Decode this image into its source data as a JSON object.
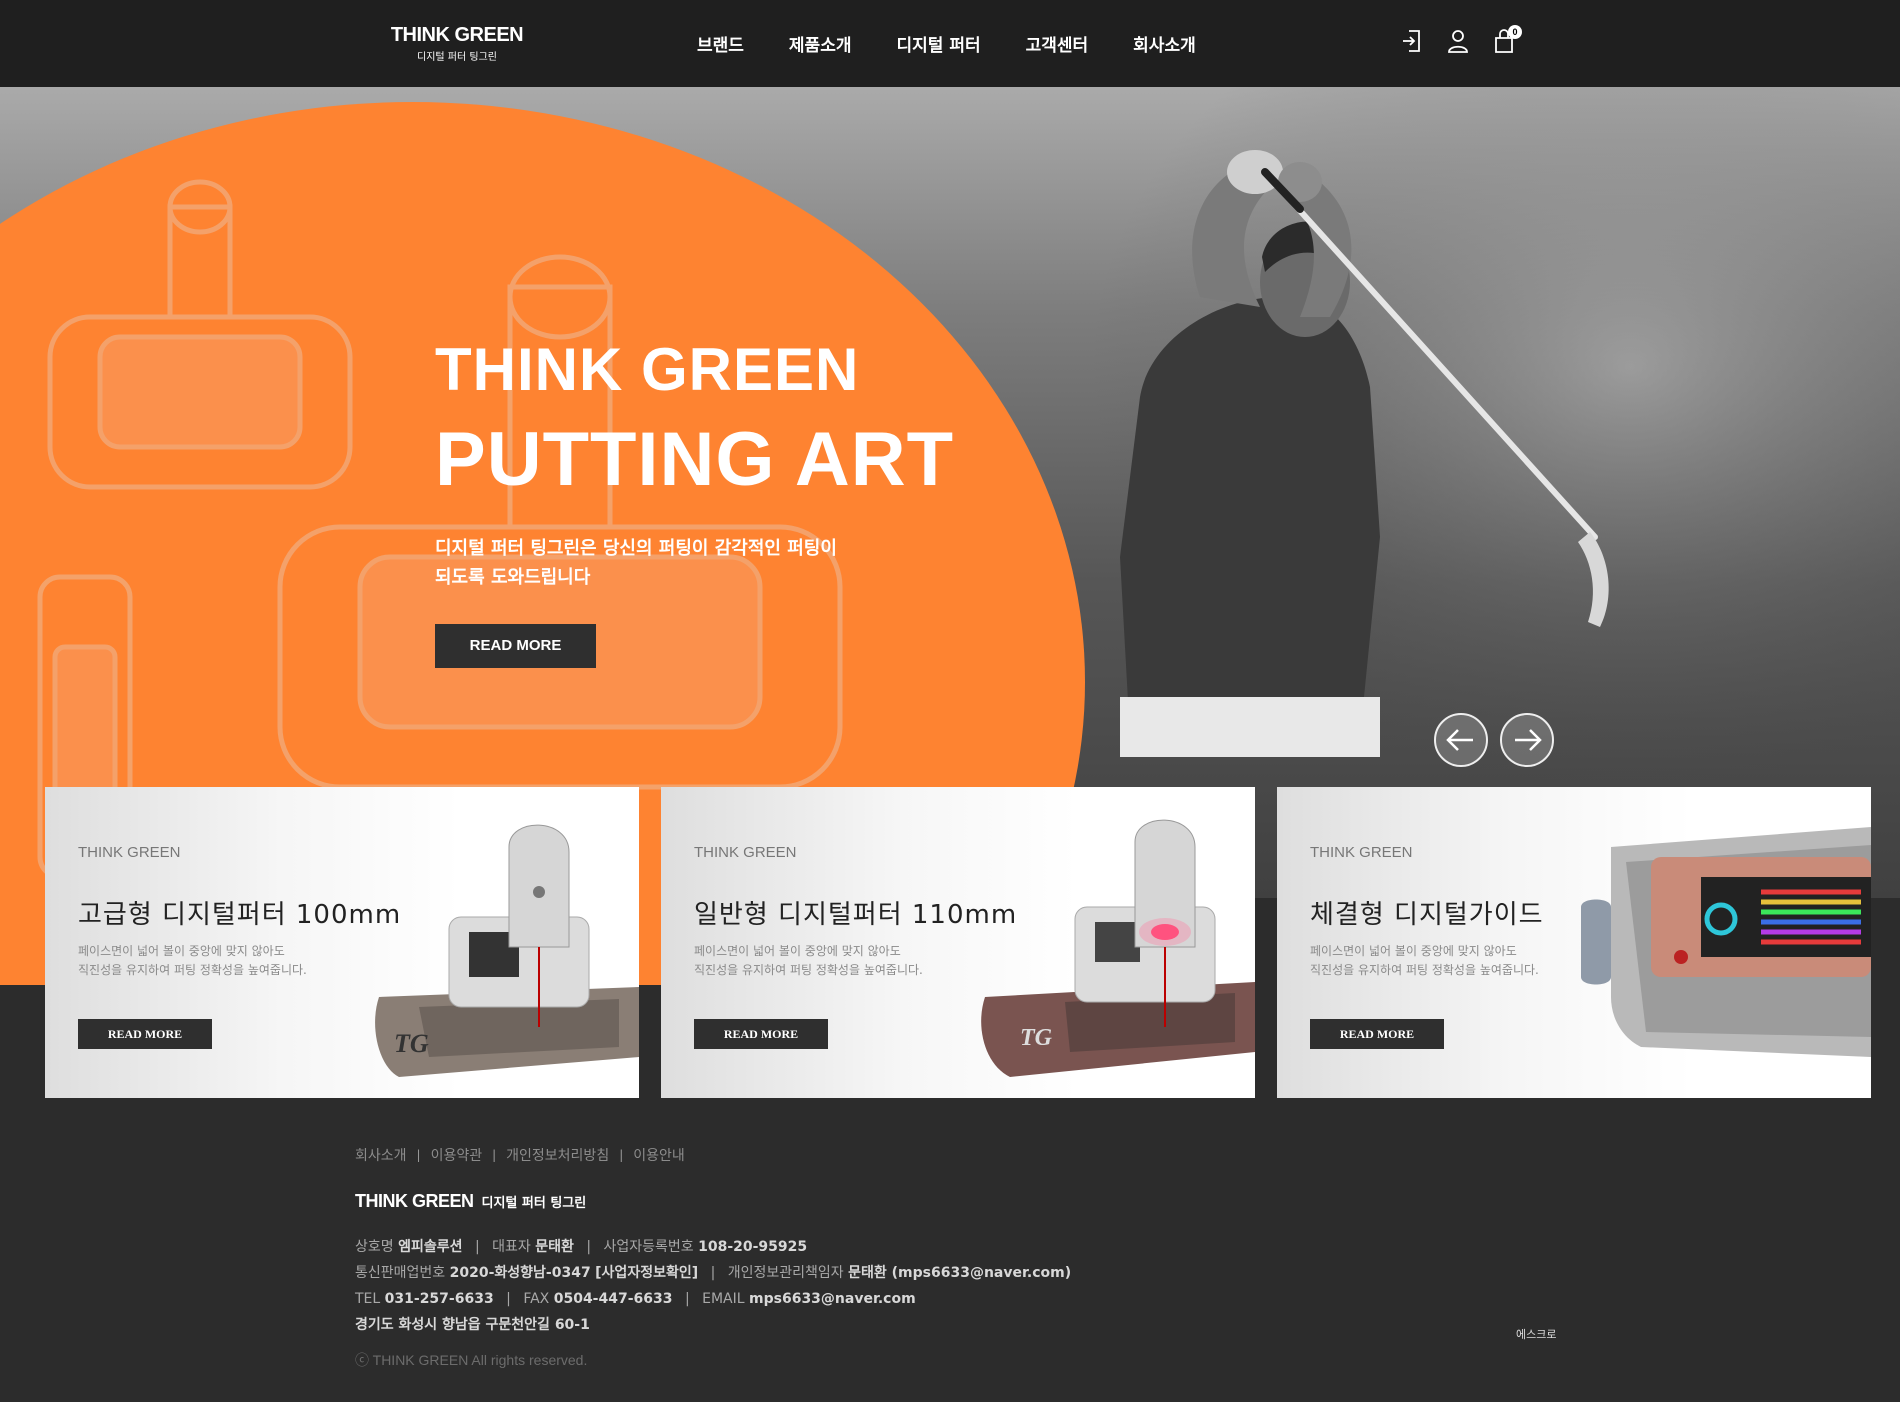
{
  "header": {
    "logo_brand": "THINK GREEN",
    "logo_sub": "디지털 퍼터 팅그린",
    "nav": [
      "브랜드",
      "제품소개",
      "디지털 퍼터",
      "고객센터",
      "회사소개"
    ],
    "cart_count": "0"
  },
  "hero": {
    "title1": "THINK GREEN",
    "title2": "PUTTING ART",
    "desc_line1": "디지털 퍼터 팅그린은 당신의 퍼팅이 감각적인 퍼팅이",
    "desc_line2": "되도록 도와드립니다",
    "button": "READ MORE"
  },
  "cards": [
    {
      "brand": "THINK GREEN",
      "title": "고급형 디지털퍼터 100mm",
      "desc1": "페이스면이 넓어 볼이 중앙에 맞지 않아도",
      "desc2": "직진성을 유지하여 퍼팅 정확성을 높여줍니다.",
      "button": "READ MORE"
    },
    {
      "brand": "THINK GREEN",
      "title": "일반형 디지털퍼터 110mm",
      "desc1": "페이스면이 넓어 볼이 중앙에 맞지 않아도",
      "desc2": "직진성을 유지하여 퍼팅 정확성을 높여줍니다.",
      "button": "READ MORE"
    },
    {
      "brand": "THINK GREEN",
      "title": "체결형 디지털가이드",
      "desc1": "페이스면이 넓어 볼이 중앙에 맞지 않아도",
      "desc2": "직진성을 유지하여 퍼팅 정확성을 높여줍니다.",
      "button": "READ MORE"
    }
  ],
  "footer": {
    "links": [
      "회사소개",
      "이용약관",
      "개인정보처리방침",
      "이용안내"
    ],
    "logo_brand": "THINK GREEN",
    "logo_sub": "디지털 퍼터 팅그린",
    "company_label": "상호명",
    "company": "엠피솔루션",
    "ceo_label": "대표자",
    "ceo": "문태환",
    "bizno_label": "사업자등록번호",
    "bizno": "108-20-95925",
    "mailorder_label": "통신판매업번호",
    "mailorder": "2020-화성향남-0347",
    "bizinfo": "[사업자정보확인]",
    "privacy_label": "개인정보관리책임자",
    "privacy": "문태환 (mps6633@naver.com)",
    "tel_label": "TEL",
    "tel": "031-257-6633",
    "fax_label": "FAX",
    "fax": "0504-447-6633",
    "email_label": "EMAIL",
    "email": "mps6633@naver.com",
    "address": "경기도 화성시 향남읍 구문천안길 60-1",
    "copyright": "ⓒ THINK GREEN All rights reserved.",
    "escrow": "에스크로"
  },
  "colors": {
    "accent": "#fe8331",
    "dark": "#2c2c2c",
    "header": "#1f1f1f"
  },
  "icons": [
    "login-icon",
    "user-icon",
    "cart-icon",
    "arrow-left-icon",
    "arrow-right-icon"
  ]
}
